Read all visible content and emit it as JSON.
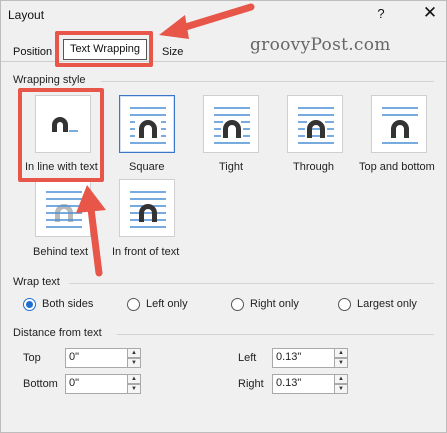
{
  "window": {
    "title": "Layout",
    "help": "?",
    "close": "✕"
  },
  "tabs": [
    {
      "label": "Position"
    },
    {
      "label": "Text Wrapping"
    },
    {
      "label": "Size"
    }
  ],
  "watermark": "groovyPost.com",
  "wrapping_style": {
    "title": "Wrapping style",
    "options": [
      {
        "label": "In line with text",
        "selected": false,
        "icon": "inline-wrap-icon"
      },
      {
        "label": "Square",
        "selected": true,
        "icon": "square-wrap-icon"
      },
      {
        "label": "Tight",
        "selected": false,
        "icon": "tight-wrap-icon"
      },
      {
        "label": "Through",
        "selected": false,
        "icon": "through-wrap-icon"
      },
      {
        "label": "Top and bottom",
        "selected": false,
        "icon": "top-bottom-wrap-icon"
      },
      {
        "label": "Behind text",
        "selected": false,
        "icon": "behind-text-icon"
      },
      {
        "label": "In front of text",
        "selected": false,
        "icon": "in-front-text-icon"
      }
    ]
  },
  "wrap_text": {
    "title": "Wrap text",
    "options": [
      {
        "label": "Both sides",
        "selected": true
      },
      {
        "label": "Left only",
        "selected": false
      },
      {
        "label": "Right only",
        "selected": false
      },
      {
        "label": "Largest only",
        "selected": false
      }
    ]
  },
  "distance": {
    "title": "Distance from text",
    "top": {
      "label": "Top",
      "value": "0\""
    },
    "bottom": {
      "label": "Bottom",
      "value": "0\""
    },
    "left": {
      "label": "Left",
      "value": "0.13\""
    },
    "right": {
      "label": "Right",
      "value": "0.13\""
    }
  },
  "colors": {
    "accent": "#3b76c9",
    "annotation": "#e8564a",
    "lines": "#4a8fd6",
    "shape": "#333333"
  }
}
